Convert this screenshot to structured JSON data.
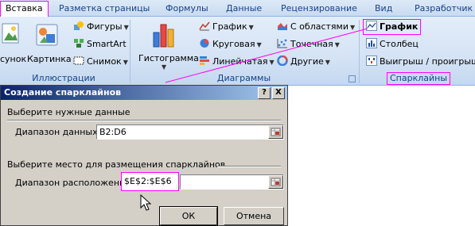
{
  "tabs": [
    {
      "label": "Вставка",
      "active": true
    },
    {
      "label": "Разметка страницы"
    },
    {
      "label": "Формулы"
    },
    {
      "label": "Данные"
    },
    {
      "label": "Рецензирование"
    },
    {
      "label": "Вид"
    },
    {
      "label": "Разработчик"
    }
  ],
  "illustrations": {
    "picture": "сунок",
    "clipart": "Картинка",
    "shapes": "Фигуры",
    "smartart": "SmartArt",
    "screenshot": "Снимок",
    "group_label": "Иллюстрации"
  },
  "charts": {
    "histogram": "Гистограмма",
    "line": "График",
    "pie": "Круговая",
    "bar": "Линейчатая",
    "area": "С областями",
    "scatter": "Точечная",
    "other": "Другие",
    "group_label": "Диаграммы"
  },
  "sparklines": {
    "line": "График",
    "column": "Столбец",
    "winloss": "Выигрыш / проигрыш",
    "group_label": "Спарклайны"
  },
  "dialog": {
    "title": "Создание спарклайнов",
    "help": "?",
    "close": "X",
    "section1": "Выберите нужные данные",
    "data_range_label": "Диапазон данных:",
    "data_range_value": "B2:D6",
    "section2": "Выберите место для размещения спарклайнов",
    "location_label": "Диапазон расположения:",
    "location_value": "$E$2:$E$6",
    "ok": "ОК",
    "cancel": "Отмена"
  },
  "colors": {
    "highlight": "#ff00ff",
    "title_bar": "#0a246a",
    "ribbon_text": "#15428b"
  }
}
